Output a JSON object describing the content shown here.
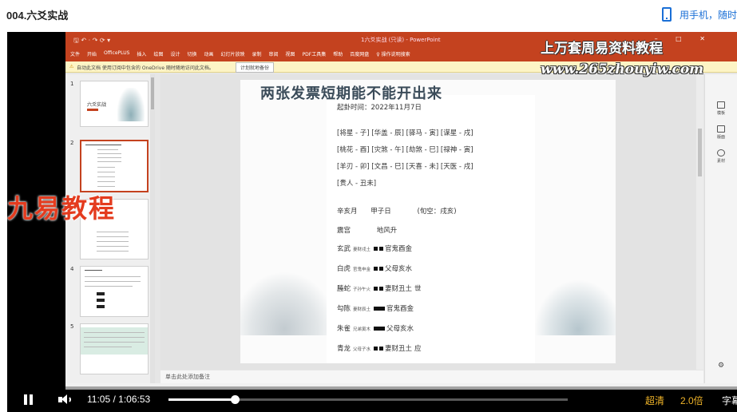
{
  "page": {
    "title": "004.六爻实战",
    "mobile_link": "用手机，随时"
  },
  "ppt": {
    "quick_access": "🖫 ↶ · ↷ ⟳ ▾",
    "window_title": "1六爻实战 (只读) - PowerPoint",
    "menu": [
      "文件",
      "开始",
      "OfficePLUS",
      "插入",
      "绘图",
      "设计",
      "切换",
      "动画",
      "幻灯片放映",
      "录制",
      "审阅",
      "视图",
      "PDF工具集",
      "帮助",
      "百度网盘",
      "♀ 操作说明搜索"
    ],
    "message": {
      "icon": "warning-icon",
      "text": "自动此文档  使用订阅中包含的 OneDrive 随时随地访问此文档。",
      "button": "计划就地备份"
    },
    "thumbnails": [
      {
        "num": "1",
        "title": "六爻实战"
      },
      {
        "num": "2"
      },
      {
        "num": "3"
      },
      {
        "num": "4"
      },
      {
        "num": "5"
      }
    ],
    "notes_placeholder": "单击此处添加备注",
    "right_panel": [
      {
        "label": "模板"
      },
      {
        "label": "版面"
      },
      {
        "label": "素材"
      }
    ]
  },
  "slide": {
    "title": "两张发票短期能不能开出来",
    "date": "起卦时间：2022年11月7日",
    "shensha": [
      "[将星 - 子] [华盖 - 辰] [驿马 - 寅] [谋星 - 戌]",
      "[桃花 - 酉] [灾煞 - 午] [劫煞 - 巳] [禄神 - 寅]",
      "[羊刃 - 卯] [文昌 - 巳] [天喜 - 未] [天医 - 戌]",
      "[贵人 - 丑未]"
    ],
    "ganzhi": {
      "month": "辛亥月",
      "day": "甲子日",
      "xunkong": "(旬空：戌亥)"
    },
    "gong": {
      "palace": "震宫",
      "gua": "地风升"
    },
    "yao": [
      {
        "god": "玄武",
        "fu": "妻财戌土",
        "line": "yin",
        "rel": "官鬼酉金",
        "mark": ""
      },
      {
        "god": "白虎",
        "fu": "官鬼申金",
        "line": "yin",
        "rel": "父母亥水",
        "mark": ""
      },
      {
        "god": "螣蛇",
        "fu": "子孙午火",
        "line": "yin",
        "rel": "妻财丑土",
        "mark": "世"
      },
      {
        "god": "勾陈",
        "fu": "妻财辰土",
        "line": "yang",
        "rel": "官鬼酉金",
        "mark": ""
      },
      {
        "god": "朱雀",
        "fu": "兄弟寅木",
        "line": "yang",
        "rel": "父母亥水",
        "mark": ""
      },
      {
        "god": "青龙",
        "fu": "父母子水",
        "line": "yin",
        "rel": "妻财丑土",
        "mark": "应"
      }
    ]
  },
  "watermarks": {
    "top": "上万套周易资料教程",
    "url": "www.265zhouyiw.com",
    "left": "九易教程"
  },
  "player": {
    "time_current": "11:05",
    "time_separator": "/",
    "time_total": "1:06:53",
    "progress": 0.1656,
    "quality": "超清",
    "speed": "2.0倍",
    "subtitles": "字幕"
  },
  "colors": {
    "accent": "#1a6fd6",
    "ribbon": "#c4421f",
    "highlight": "#f0b429"
  }
}
